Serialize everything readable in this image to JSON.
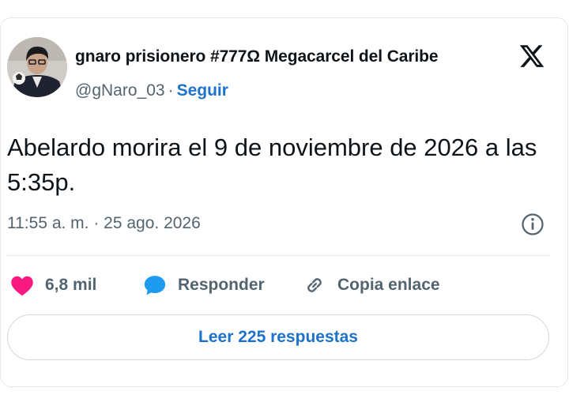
{
  "tweet": {
    "author": {
      "display_name": "gnaro prisionero #777Ω Megacarcel del Caribe",
      "handle": "@gNaro_03",
      "separator": "·",
      "follow_label": "Seguir"
    },
    "platform_icon": "x-logo-icon",
    "text": "Abelardo morira el 9 de noviembre de 2026 a las 5:35p.",
    "timestamp": "11:55 a. m. · 25 ago. 2026",
    "info_icon": "info-circle-icon",
    "actions": {
      "like_count": "6,8 mil",
      "reply_label": "Responder",
      "copy_link_label": "Copia enlace"
    },
    "read_replies_label": "Leer 225 respuestas"
  },
  "colors": {
    "link_blue": "#1d72c9",
    "heart_pink": "#f91880",
    "reply_blue": "#1d9bf0",
    "secondary_text": "#536471",
    "border": "#cfd9de"
  }
}
